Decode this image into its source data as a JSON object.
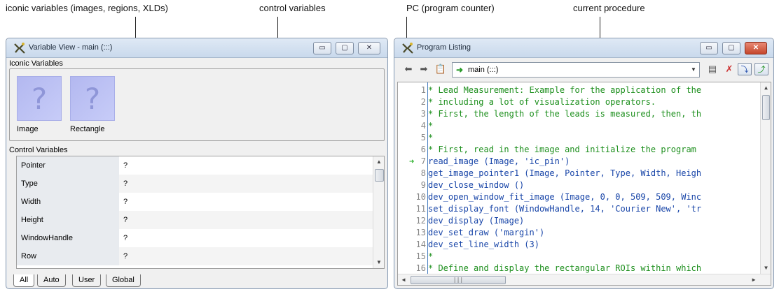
{
  "callouts": {
    "iconic": "iconic variables (images, regions, XLDs)",
    "control": "control variables",
    "pc": "PC (program counter)",
    "procedure": "current procedure"
  },
  "variable_view": {
    "title": "Variable View - main (:::)",
    "iconic_label": "Iconic Variables",
    "iconic_items": [
      {
        "name": "Image",
        "thumb": "?"
      },
      {
        "name": "Rectangle",
        "thumb": "?"
      }
    ],
    "control_label": "Control Variables",
    "control_rows": [
      {
        "name": "Pointer",
        "value": "?"
      },
      {
        "name": "Type",
        "value": "?"
      },
      {
        "name": "Width",
        "value": "?"
      },
      {
        "name": "Height",
        "value": "?"
      },
      {
        "name": "WindowHandle",
        "value": "?"
      },
      {
        "name": "Row",
        "value": "?"
      }
    ],
    "tabs": [
      "All",
      "Auto",
      "User",
      "Global"
    ],
    "active_tab": "All"
  },
  "program_listing": {
    "title": "Program Listing",
    "procedure": "main (:::)",
    "pc_line": 7,
    "lines": [
      {
        "n": "1",
        "text": "* Lead Measurement: Example for the application of the",
        "kind": "cmt"
      },
      {
        "n": "2",
        "text": "* including a lot of visualization operators.",
        "kind": "cmt"
      },
      {
        "n": "3",
        "text": "* First, the length of the leads is measured, then, th",
        "kind": "cmt"
      },
      {
        "n": "4",
        "text": "*",
        "kind": "cmt"
      },
      {
        "n": "5",
        "text": "*",
        "kind": "cmt"
      },
      {
        "n": "6",
        "text": "* First, read in the image and initialize the program",
        "kind": "cmt"
      },
      {
        "n": "7",
        "text": "read_image (Image, 'ic_pin')",
        "kind": "op"
      },
      {
        "n": "8",
        "text": "get_image_pointer1 (Image, Pointer, Type, Width, Heigh",
        "kind": "op"
      },
      {
        "n": "9",
        "text": "dev_close_window ()",
        "kind": "op"
      },
      {
        "n": "10",
        "text": "dev_open_window_fit_image (Image, 0, 0, 509, 509, Winc",
        "kind": "op"
      },
      {
        "n": "11",
        "text": "set_display_font (WindowHandle, 14, 'Courier New', 'tr",
        "kind": "op"
      },
      {
        "n": "12",
        "text": "dev_display (Image)",
        "kind": "op"
      },
      {
        "n": "13",
        "text": "dev_set_draw ('margin')",
        "kind": "op"
      },
      {
        "n": "14",
        "text": "dev_set_line_width (3)",
        "kind": "op"
      },
      {
        "n": "15",
        "text": "*",
        "kind": "cmt"
      },
      {
        "n": "16",
        "text": "* Define and display the rectangular ROIs within which",
        "kind": "cmt"
      }
    ]
  },
  "window_buttons": {
    "minimize": "▭",
    "maximize": "▢",
    "close": "✕"
  },
  "colors": {
    "comment": "#1d8f1d",
    "operator": "#1845a8",
    "pc_arrow": "#2bb02b",
    "thumb": "#b3b8f0"
  }
}
